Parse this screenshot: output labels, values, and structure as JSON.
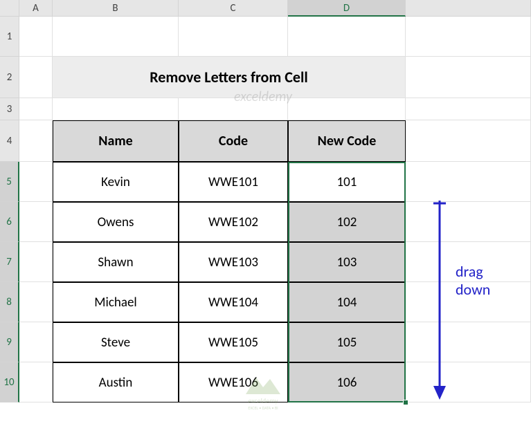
{
  "columns": [
    "",
    "A",
    "B",
    "C",
    "D",
    ""
  ],
  "rows": [
    "1",
    "2",
    "3",
    "4",
    "5",
    "6",
    "7",
    "8",
    "9",
    "10"
  ],
  "active_column": "D",
  "active_rows": [
    "5",
    "6",
    "7",
    "8",
    "9",
    "10"
  ],
  "title": "Remove Letters from Cell",
  "annotation": "drag down",
  "watermark": "exceldemy",
  "watermark_sub": "EXCEL • DATA • BI",
  "chart_data": {
    "type": "table",
    "headers": [
      "Name",
      "Code",
      "New Code"
    ],
    "rows": [
      {
        "name": "Kevin",
        "code": "WWE101",
        "new_code": "101"
      },
      {
        "name": "Owens",
        "code": "WWE102",
        "new_code": "102"
      },
      {
        "name": "Shawn",
        "code": "WWE103",
        "new_code": "103"
      },
      {
        "name": "Michael",
        "code": "WWE104",
        "new_code": "104"
      },
      {
        "name": "Steve",
        "code": "WWE105",
        "new_code": "105"
      },
      {
        "name": "Austin",
        "code": "WWE106",
        "new_code": "106"
      }
    ]
  }
}
